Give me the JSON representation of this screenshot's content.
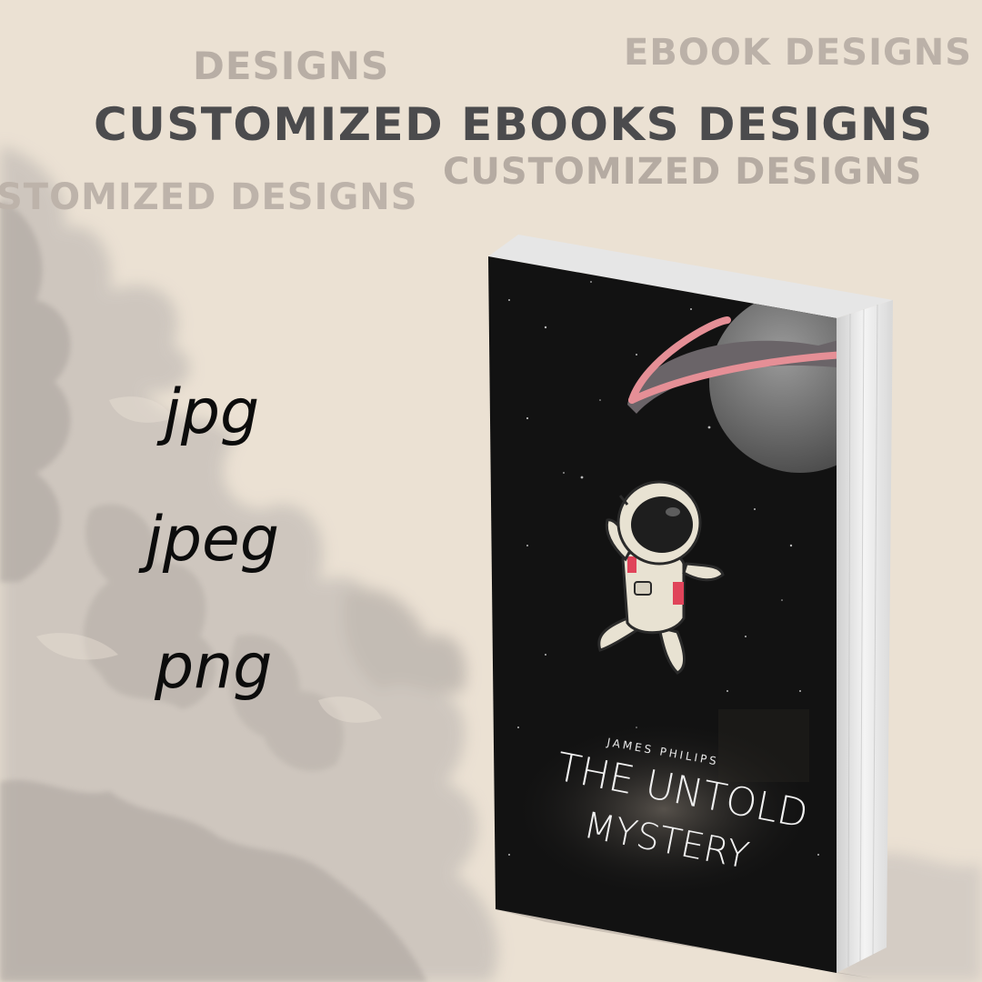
{
  "headings": {
    "designs": "DESIGNS",
    "ebook_designs": "EBOOK DESIGNS",
    "main": "CUSTOMIZED EBOOKS DESIGNS",
    "customized_right": "CUSTOMIZED DESIGNS",
    "customized_left": "STOMIZED DESIGNS"
  },
  "formats": [
    "jpg",
    "jpeg",
    "png"
  ],
  "book": {
    "author": "JAMES PHILIPS",
    "title_line1": "THE UNTOLD",
    "title_line2": "MYSTERY",
    "icon": "astronaut-icon"
  },
  "colors": {
    "background": "#ebe1d3",
    "heading_dark": "#4b4b4d",
    "heading_light": "#b8aea5",
    "cover": "#121212",
    "planet_ring": "#e58f96"
  }
}
